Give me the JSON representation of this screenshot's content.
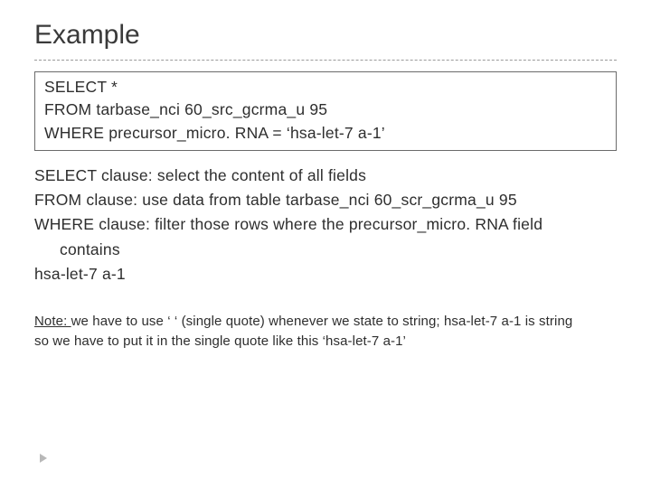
{
  "title": "Example",
  "query": {
    "line1": "SELECT  *",
    "line2": "FROM  tarbase_nci 60_src_gcrma_u 95",
    "line3": "WHERE precursor_micro. RNA = ‘hsa-let-7 a-1’"
  },
  "explain": {
    "select": "SELECT clause:  select the content of all fields",
    "from": "FROM clause:  use data from table tarbase_nci 60_scr_gcrma_u 95",
    "where_lead": "WHERE clause:  filter those rows where the precursor_micro. RNA field",
    "where_indent": "contains",
    "where_val": "hsa-let-7 a-1"
  },
  "note": {
    "label": "Note: ",
    "line1_rest": "we have to use ‘ ‘ (single quote) whenever we state to string; hsa-let-7 a-1 is string",
    "line2": "so we have to put it in the single quote like this  ‘hsa-let-7 a-1’"
  }
}
